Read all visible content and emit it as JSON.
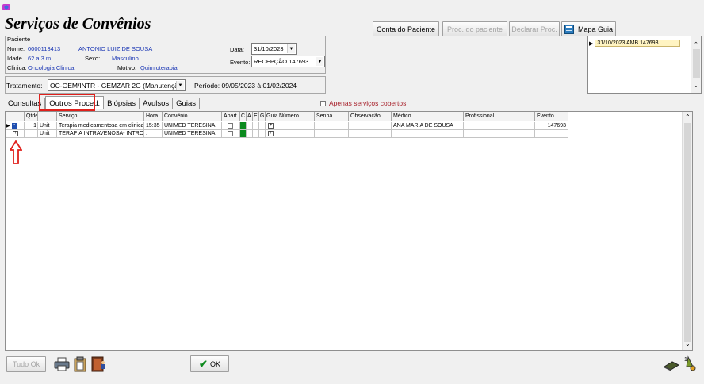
{
  "window": {
    "title": "Serviços de Convênios"
  },
  "toolbar": {
    "conta_paciente": "Conta do Paciente",
    "proc_paciente": "Proc. do paciente",
    "declarar_proc": "Declarar Proc.",
    "mapa_guia": "Mapa Guia"
  },
  "patient": {
    "section_label": "Paciente",
    "nome_label": "Nome:",
    "nome_id": "0000113413",
    "nome_value": "ANTONIO LUIZ DE SOUSA",
    "idade_label": "Idade",
    "idade_value": "62 a 3 m",
    "sexo_label": "Sexo:",
    "sexo_value": "Masculino",
    "clinica_label": "Clinica:",
    "clinica_value": "Oncologia Clinica",
    "motivo_label": "Motivo:",
    "motivo_value": "Quimioterapia",
    "data_label": "Data:",
    "data_value": "31/10/2023",
    "evento_label": "Evento:",
    "evento_value": "RECEPÇÃO 147693"
  },
  "event_list": {
    "items": [
      "31/10/2023  AMB 147693"
    ]
  },
  "tratamento": {
    "label": "Tratamento:",
    "value": "OC-GEM/INTR - GEMZAR 2G (Manutençã",
    "periodo": "Período: 09/05/2023 à 01/02/2024"
  },
  "tabs": [
    "Consultas",
    "Outros Proced.",
    "Biópsias",
    "Avulsos",
    "Guias"
  ],
  "apenas_label": "Apenas serviços cobertos",
  "grid": {
    "columns": [
      "",
      "Qtde",
      "Serviço",
      "Hora",
      "Convênio",
      "Apart.",
      "C",
      "A",
      "E",
      "G",
      "Guia",
      "Número",
      "Senha",
      "Observação",
      "Médico",
      "Profissional",
      "Evento"
    ],
    "rows": [
      {
        "qtde": "1",
        "unit": "Unit",
        "servico": "Terapia medicamentosa em clinica",
        "hora": "15:35",
        "convenio": "UNIMED TERESINA",
        "medico": "ANA MARIA DE SOUSA",
        "evento": "147693"
      },
      {
        "qtde": "",
        "unit": "Unit",
        "servico": "TERAPIA INTRAVENOSA- INTRODI",
        "hora": ":",
        "convenio": "UNIMED TERESINA",
        "medico": "",
        "evento": ""
      }
    ]
  },
  "footer": {
    "tudo_ok": "Tudo Ok",
    "ok": "OK"
  },
  "colors": {
    "highlight": "#e0201c",
    "label_blue": "#1a36b4",
    "status_green": "#0b8a1e"
  }
}
